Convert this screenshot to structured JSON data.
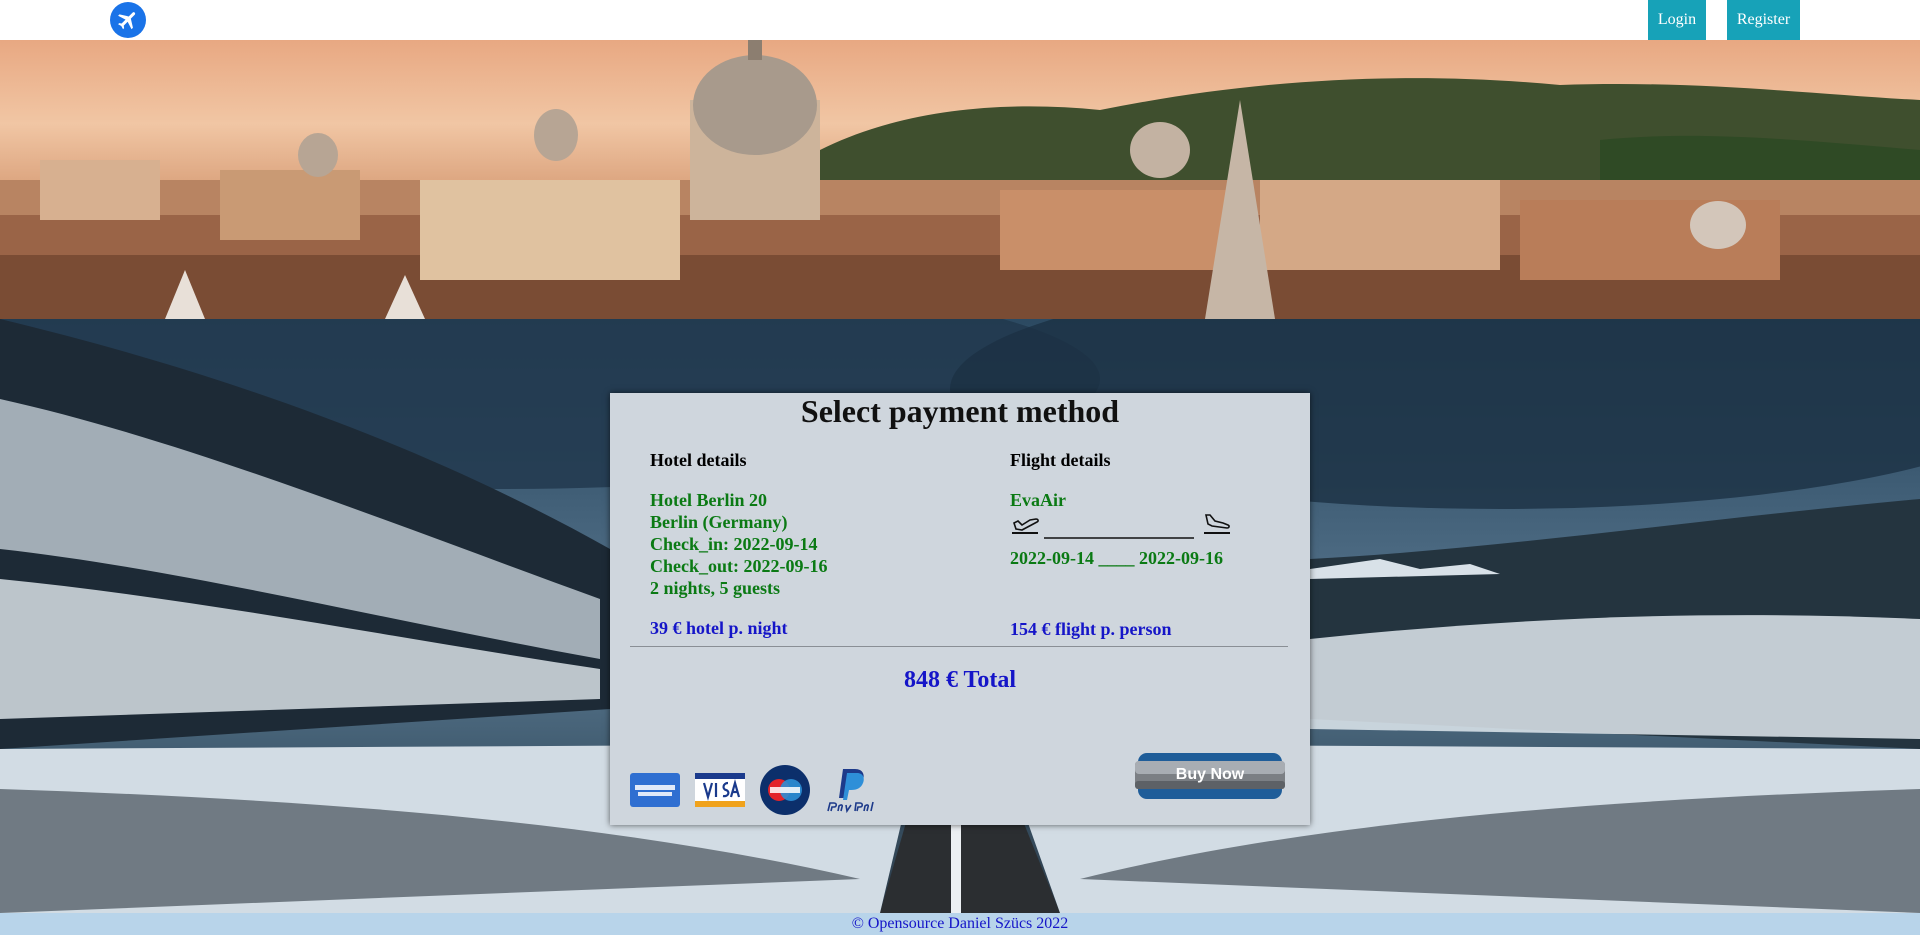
{
  "nav": {
    "login": "Login",
    "register": "Register"
  },
  "icons": {
    "logo": "airplane-icon",
    "takeoff": "takeoff-icon",
    "landing": "landing-icon"
  },
  "colors": {
    "nav_button": "#17a2b8",
    "green_text": "#0b7a14",
    "blue_text": "#1515c8",
    "footer_bg": "#b8d4ea"
  },
  "card": {
    "title": "Select payment method",
    "hotel": {
      "heading": "Hotel details",
      "name": "Hotel Berlin 20",
      "location": "Berlin (Germany)",
      "check_in": "Check_in: 2022-09-14",
      "check_out": "Check_out: 2022-09-16",
      "stay": "2 nights, 5 guests",
      "price": "39 € hotel p. night"
    },
    "flight": {
      "heading": "Flight details",
      "airline": "EvaAir",
      "dates": "2022-09-14 ____ 2022-09-16",
      "price": "154 € flight p. person"
    },
    "total": "848 € Total",
    "payment_methods": [
      "American Express",
      "VISA",
      "Maestro",
      "PayPal"
    ],
    "buy_label": "Buy Now"
  },
  "footer": "© Opensource Daniel Szücs 2022"
}
